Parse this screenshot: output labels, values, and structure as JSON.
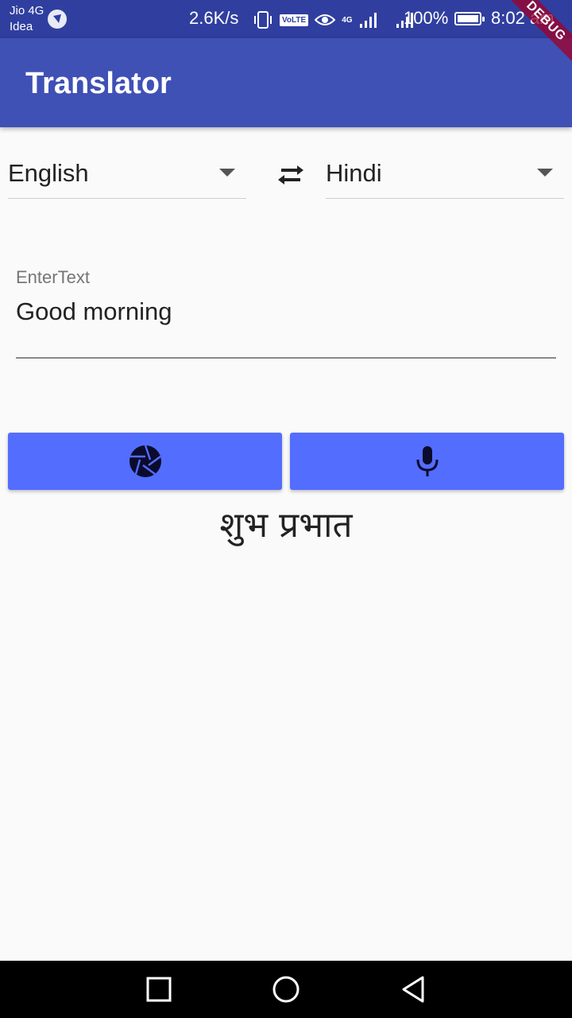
{
  "status_bar": {
    "carrier_1": "Jio 4G",
    "carrier_2": "Idea",
    "net_speed": "2.6K/s",
    "volte": "VoLTE",
    "network_type": "4G",
    "battery": "100%",
    "time": "8:02 am",
    "icons": [
      "vibrate-icon",
      "volte-icon",
      "eye-icon",
      "signal-icon",
      "signal-icon",
      "battery-icon"
    ]
  },
  "debug_ribbon": "DEBUG",
  "app_bar": {
    "title": "Translator"
  },
  "languages": {
    "source": "English",
    "target": "Hindi",
    "swap_icon": "swap-horiz-icon"
  },
  "input": {
    "label": "EnterText",
    "value": "Good morning"
  },
  "buttons": {
    "camera_icon": "camera-shutter-icon",
    "mic_icon": "mic-icon"
  },
  "output": {
    "text": "शुभ प्रभात"
  },
  "nav": {
    "icons": [
      "recent-apps-icon",
      "home-icon",
      "back-icon"
    ]
  },
  "colors": {
    "status_bar": "#303f9f",
    "app_bar": "#3f51b5",
    "button": "#536dfe",
    "background": "#fafafa"
  }
}
